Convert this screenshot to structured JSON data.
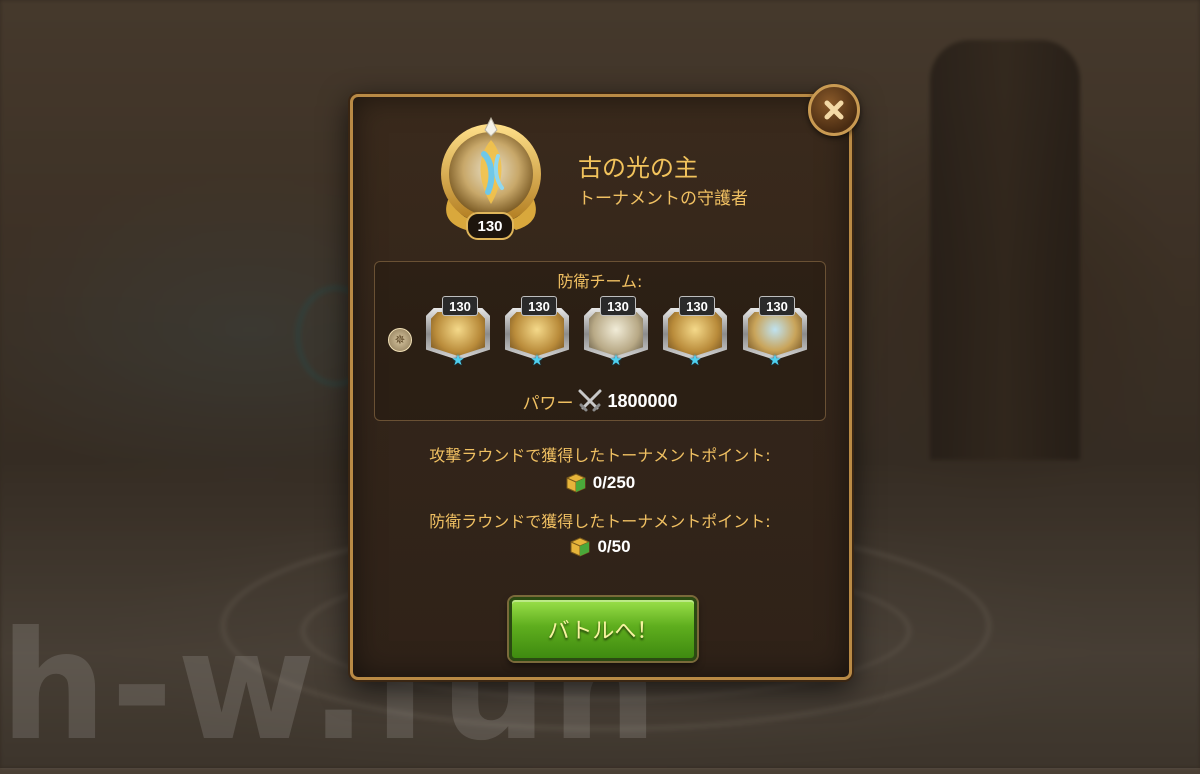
{
  "watermark": "h-w.fun",
  "opponent": {
    "name": "古の光の主",
    "title": "トーナメントの守護者",
    "level": "130"
  },
  "defense_team": {
    "label": "防衛チーム:",
    "heroes": [
      {
        "level": "130"
      },
      {
        "level": "130"
      },
      {
        "level": "130"
      },
      {
        "level": "130"
      },
      {
        "level": "130"
      }
    ],
    "power_label": "パワー",
    "power_value": "1800000"
  },
  "points": {
    "attack_label": "攻撃ラウンドで獲得したトーナメントポイント:",
    "attack_value": "0/250",
    "defense_label": "防衛ラウンドで獲得したトーナメントポイント:",
    "defense_value": "0/50"
  },
  "battle_button": "バトルへ！",
  "icons": {
    "close": "close-icon",
    "power": "crossed-swords-icon",
    "points": "tournament-cube-icon",
    "star": "star-icon"
  },
  "colors": {
    "gold_text": "#f0c062",
    "button_green": "#5fae1e",
    "frame_gold": "#b98a45"
  }
}
